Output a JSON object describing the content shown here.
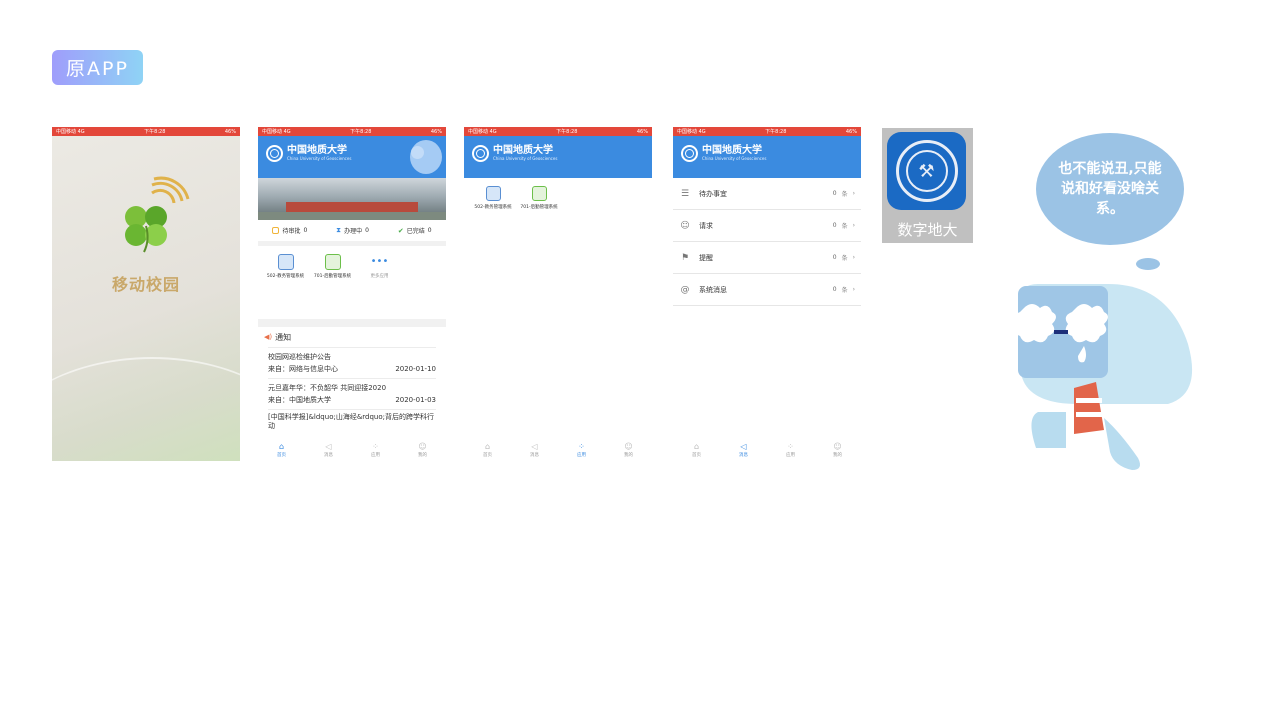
{
  "badge": "原APP",
  "status": {
    "carrier": "中国移动 4G",
    "time": "下午8:28",
    "battery": "46%"
  },
  "splash": {
    "title": "移动校园"
  },
  "logo": {
    "cn": "中国地质大学",
    "en": "China University of Geosciences"
  },
  "home": {
    "stats": [
      {
        "label": "待审批",
        "value": "0"
      },
      {
        "label": "办理中",
        "value": "0"
      },
      {
        "label": "已完结",
        "value": "0"
      }
    ],
    "apps": [
      {
        "label": "502-教务管理系统"
      },
      {
        "label": "701-后勤管理系统"
      },
      {
        "label": "更多应用"
      }
    ],
    "notice_title": "通知",
    "notices": [
      {
        "title": "校园网巡检维护公告",
        "from": "来自：网络与信息中心",
        "date": "2020-01-10"
      },
      {
        "title": "元旦嘉年华：不负韶华 共同迎接2020",
        "from": "来自：中国地质大学",
        "date": "2020-01-03"
      },
      {
        "title": "[中国科学报]&ldquo;山海经&rdquo;背后的跨学科行动"
      }
    ]
  },
  "tabs": [
    "首页",
    "消息",
    "应用",
    "我的"
  ],
  "messages": [
    {
      "label": "待办事宜",
      "count": "0",
      "unit": "条"
    },
    {
      "label": "请求",
      "count": "0",
      "unit": "条"
    },
    {
      "label": "提醒",
      "count": "0",
      "unit": "条"
    },
    {
      "label": "系统消息",
      "count": "0",
      "unit": "条"
    }
  ],
  "icon_tile": {
    "label": "数字地大"
  },
  "bubble": {
    "text": "也不能说丑,只能说和好看没啥关系。"
  }
}
